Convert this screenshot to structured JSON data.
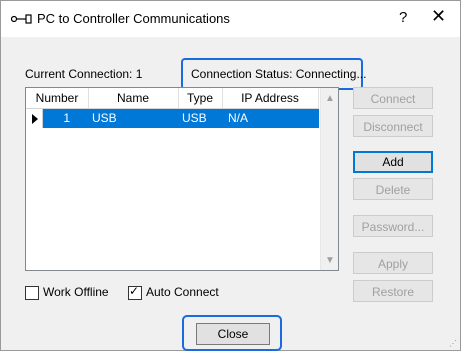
{
  "window": {
    "title": "PC to Controller Communications",
    "help_label": "?",
    "close_glyph": "✕",
    "icon": "connector-icon"
  },
  "connection": {
    "current_label": "Current Connection: 1",
    "status_label": "Connection Status: Connecting..."
  },
  "table": {
    "columns": [
      "Number",
      "Name",
      "Type",
      "IP Address"
    ],
    "rows": [
      {
        "number": "1",
        "name": "USB",
        "type": "USB",
        "ip": "N/A",
        "selected": true
      }
    ]
  },
  "buttons": {
    "connect": "Connect",
    "disconnect": "Disconnect",
    "add": "Add",
    "delete": "Delete",
    "password": "Password...",
    "apply": "Apply",
    "restore": "Restore",
    "close": "Close"
  },
  "options": {
    "work_offline": {
      "label": "Work Offline",
      "checked": false
    },
    "auto_connect": {
      "label": "Auto Connect",
      "checked": true
    }
  },
  "colors": {
    "highlight": "#1a6be0",
    "selection": "#0078d7"
  }
}
